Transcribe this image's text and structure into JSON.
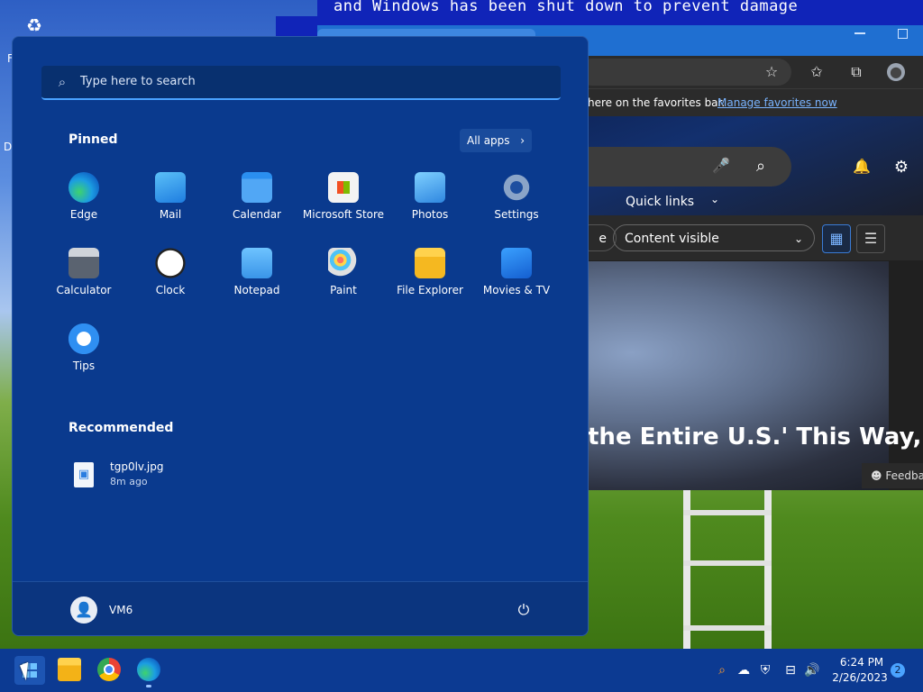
{
  "background": {
    "bsod_text": "and Windows has been shut down to prevent damage"
  },
  "browser": {
    "favorites_text": "here on the favorites bar.",
    "favorites_link": "Manage favorites now",
    "quick_links": "Quick links",
    "filter_left": "e",
    "content_select": "Content visible",
    "headline": "the Entire U.S.' This Way,",
    "feedback": "Feedba"
  },
  "start_menu": {
    "search_placeholder": "Type here to search",
    "pinned_title": "Pinned",
    "all_apps_label": "All apps",
    "pinned_apps": [
      {
        "label": "Edge",
        "icon": "edge-icon"
      },
      {
        "label": "Mail",
        "icon": "mail-icon"
      },
      {
        "label": "Calendar",
        "icon": "calendar-icon"
      },
      {
        "label": "Microsoft Store",
        "icon": "store-icon"
      },
      {
        "label": "Photos",
        "icon": "photos-icon"
      },
      {
        "label": "Settings",
        "icon": "settings-icon"
      },
      {
        "label": "Calculator",
        "icon": "calculator-icon"
      },
      {
        "label": "Clock",
        "icon": "clock-icon"
      },
      {
        "label": "Notepad",
        "icon": "notepad-icon"
      },
      {
        "label": "Paint",
        "icon": "paint-icon"
      },
      {
        "label": "File Explorer",
        "icon": "folder-icon"
      },
      {
        "label": "Movies & TV",
        "icon": "movies-icon"
      },
      {
        "label": "Tips",
        "icon": "tips-icon"
      }
    ],
    "recommended_title": "Recommended",
    "recommended": [
      {
        "name": "tgp0lv.jpg",
        "time": "8m ago"
      }
    ],
    "user_name": "VM6"
  },
  "taskbar": {
    "time": "6:24 PM",
    "date": "2/26/2023",
    "notification_count": "2"
  },
  "colors": {
    "start_bg": "#0a3a8e",
    "taskbar_bg": "#0c3a92",
    "accent": "#4aa3ff"
  }
}
